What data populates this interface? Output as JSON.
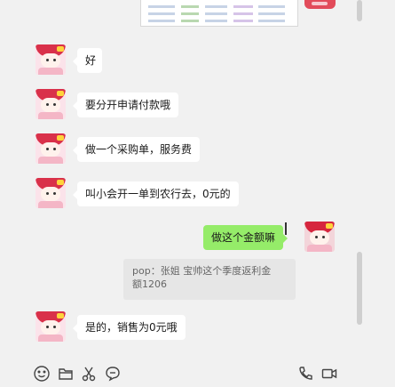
{
  "messages": [
    {
      "sender": "other",
      "text": "好"
    },
    {
      "sender": "other",
      "text": "要分开申请付款哦"
    },
    {
      "sender": "other",
      "text": "做一个采购单，服务费"
    },
    {
      "sender": "other",
      "text": "叫小会开一单到农行去，0元的"
    },
    {
      "sender": "me",
      "text": "做这个金额嘛"
    },
    {
      "sender": "other",
      "text": "是的，销售为0元哦"
    }
  ],
  "quote": {
    "line1": "pop：张姐 宝帅这个季度返利金",
    "line2": "额1206"
  },
  "toolbar": {
    "icons": [
      "emoji-icon",
      "folder-icon",
      "scissors-icon",
      "chat-bubble-icon",
      "phone-icon",
      "video-icon"
    ]
  },
  "colors": {
    "background": "#f1f1f1",
    "bubble_other": "#ffffff",
    "bubble_me": "#95ec69",
    "quote_bg": "#e6e6e6"
  }
}
